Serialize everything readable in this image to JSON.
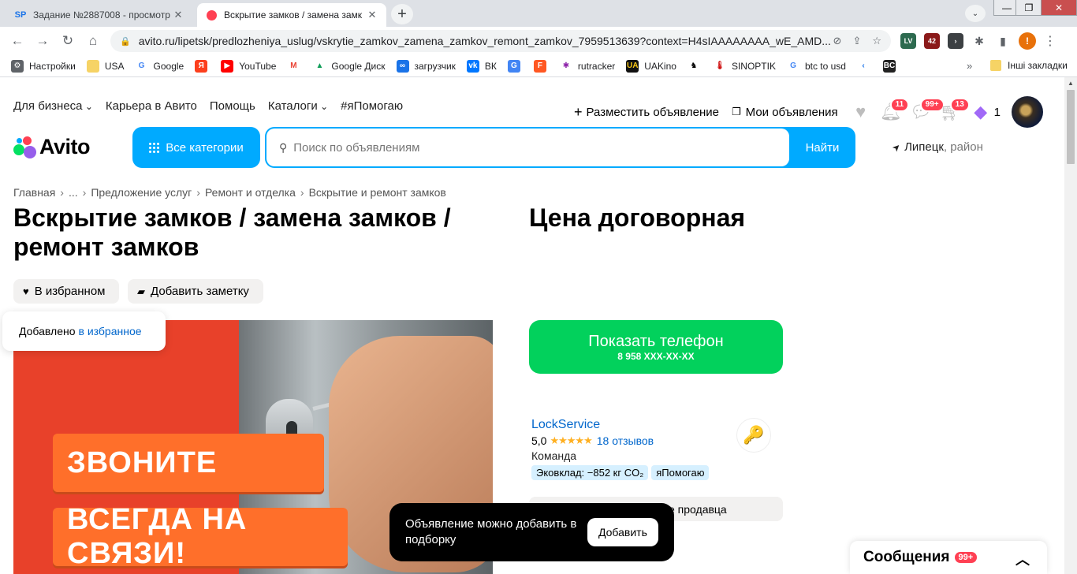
{
  "browser": {
    "tabs": [
      {
        "favicon": "SP",
        "title": "Задание №2887008 - просмотр"
      },
      {
        "favicon": "avito-favicon",
        "title": "Вскрытие замков / замена замк"
      }
    ],
    "url": "avito.ru/lipetsk/predlozheniya_uslug/vskrytie_zamkov_zamena_zamkov_remont_zamkov_7959513639?context=H4sIAAAAAAAA_wE_AMD...",
    "extensions": [
      {
        "name": "lv-extension-icon",
        "label": "LV",
        "color": "#2d6a4f"
      },
      {
        "name": "badge-extension-icon",
        "label": "42",
        "color": "#8b1a1a"
      },
      {
        "name": "terminal-extension-icon",
        "label": "›",
        "color": "#3c4043"
      },
      {
        "name": "puzzle-icon",
        "label": "✱",
        "color": "#5f6368"
      },
      {
        "name": "sidepanel-icon",
        "label": "▮",
        "color": "#5f6368"
      }
    ],
    "profile_initial": "!",
    "bookmarks": [
      {
        "icon": "⚙",
        "label": "Настройки",
        "color": "#5f6368",
        "text": "#fff"
      },
      {
        "icon": "",
        "label": "USA",
        "color": "#f6d365",
        "text": "#000"
      },
      {
        "icon": "G",
        "label": "Google",
        "color": "#fff",
        "text": "#4285f4"
      },
      {
        "icon": "Я",
        "label": "",
        "color": "#fc3f1d",
        "text": "#fff"
      },
      {
        "icon": "▶",
        "label": "YouTube",
        "color": "#ff0000",
        "text": "#fff"
      },
      {
        "icon": "M",
        "label": "",
        "color": "#fff",
        "text": "#ea4335"
      },
      {
        "icon": "▲",
        "label": "Google Диск",
        "color": "#fff",
        "text": "#0f9d58"
      },
      {
        "icon": "∞",
        "label": "загрузчик",
        "color": "#1a73e8",
        "text": "#fff"
      },
      {
        "icon": "vk",
        "label": "ВК",
        "color": "#0077ff",
        "text": "#fff"
      },
      {
        "icon": "G",
        "label": "",
        "color": "#4285f4",
        "text": "#fff"
      },
      {
        "icon": "F",
        "label": "",
        "color": "#ff5722",
        "text": "#fff"
      },
      {
        "icon": "✱",
        "label": "rutracker",
        "color": "#fff",
        "text": "#8e24aa"
      },
      {
        "icon": "UA",
        "label": "UAKino",
        "color": "#111",
        "text": "#f5c518"
      },
      {
        "icon": "♞",
        "label": "",
        "color": "#fff",
        "text": "#000"
      },
      {
        "icon": "🌡",
        "label": "SINOPTIK",
        "color": "#fff",
        "text": "#c00"
      },
      {
        "icon": "G",
        "label": "btc to usd",
        "color": "#fff",
        "text": "#4285f4"
      },
      {
        "icon": "‹",
        "label": "",
        "color": "#fff",
        "text": "#1a73e8"
      },
      {
        "icon": "BC",
        "label": "",
        "color": "#222",
        "text": "#fff"
      }
    ],
    "other_bookmarks": "Інші закладки"
  },
  "header": {
    "nav": [
      "Для бизнеса",
      "Карьера в Авито",
      "Помощь",
      "Каталоги",
      "#яПомогаю"
    ],
    "post_ad": "Разместить объявление",
    "my_ads": "Мои объявления",
    "notifications_count": "11",
    "messages_count": "99+",
    "cart_count": "13",
    "bonus_count": "1",
    "logo_text": "Avito",
    "all_categories": "Все категории",
    "search_placeholder": "Поиск по объявлениям",
    "search_button": "Найти",
    "location_city": "Липецк",
    "location_suffix": ", район"
  },
  "breadcrumb": [
    "Главная",
    "...",
    "Предложение услуг",
    "Ремонт и отделка",
    "Вскрытие и ремонт замков"
  ],
  "ad": {
    "title": "Вскрытие замков / замена замков / ремонт замков",
    "price": "Цена договорная",
    "favorite_button": "В избранном",
    "note_button": "Добавить заметку",
    "favorite_popup_text": "Добавлено",
    "favorite_popup_link": "в избранное",
    "photo_text_1": "ЗВОНИТЕ",
    "photo_text_2": "ВСЕГДА НА СВЯЗИ!"
  },
  "contact": {
    "show_phone": "Показать телефон",
    "phone_masked": "8 958 XXX-XX-XX"
  },
  "seller": {
    "name": "LockService",
    "rating": "5,0",
    "stars": "★★★★★",
    "reviews": "18 отзывов",
    "type": "Команда",
    "tags": [
      "Эковклад: −852 кг CO₂",
      "яПомогаю"
    ],
    "ask_strip": "е продавца"
  },
  "toast": {
    "text": "Объявление можно добавить в подборку",
    "button": "Добавить"
  },
  "messenger": {
    "title": "Сообщения",
    "badge": "99+"
  }
}
